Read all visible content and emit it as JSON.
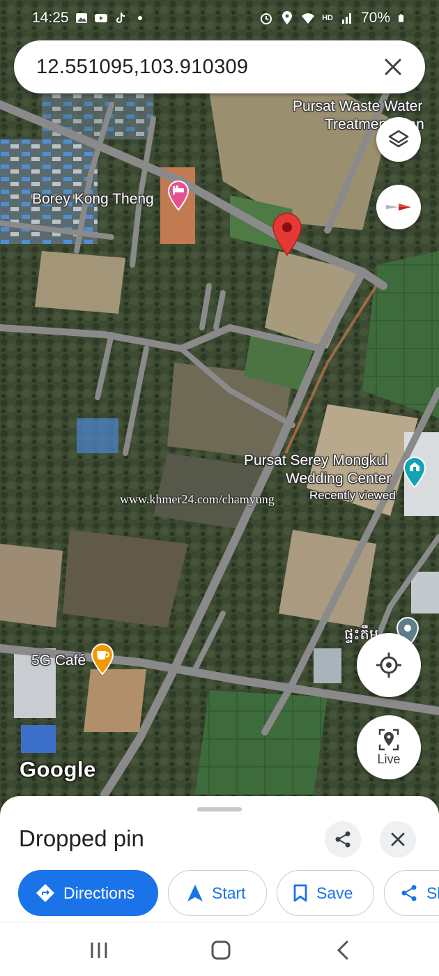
{
  "status_bar": {
    "time": "14:25",
    "battery": "70%",
    "network": "HD",
    "icons": [
      "gallery-icon",
      "youtube-icon",
      "tiktok-icon",
      "dot-icon",
      "alarm-icon",
      "location-icon",
      "wifi-icon",
      "signal-icon",
      "battery-icon"
    ]
  },
  "search": {
    "query": "12.551095,103.910309"
  },
  "map": {
    "labels": {
      "waste_water_line1": "Pursat Waste Water",
      "waste_water_line2": "Treatment Plan",
      "borey": "Borey Kong Theng",
      "serey_line1": "Pursat Serey Mongkul",
      "serey_line2": "Wedding Center",
      "recently_viewed": "Recently viewed",
      "cafe": "5G Café",
      "khmer": "ផ្ទះតឹម"
    },
    "watermark": "www.khmer24.com/chamyung",
    "logo": "Google",
    "live_label": "Live",
    "colors": {
      "pin": "#e53935",
      "poi_pink": "#e8508e",
      "poi_teal": "#12a4b4",
      "poi_orange": "#f29900",
      "road": "#8a8a8a"
    }
  },
  "sheet": {
    "title": "Dropped pin",
    "chips": {
      "directions": "Directions",
      "start": "Start",
      "save": "Save",
      "share": "Share"
    },
    "colors": {
      "primary": "#1a73e8"
    }
  },
  "nav_bar": {
    "icons": [
      "recents-icon",
      "home-icon",
      "back-icon"
    ]
  }
}
